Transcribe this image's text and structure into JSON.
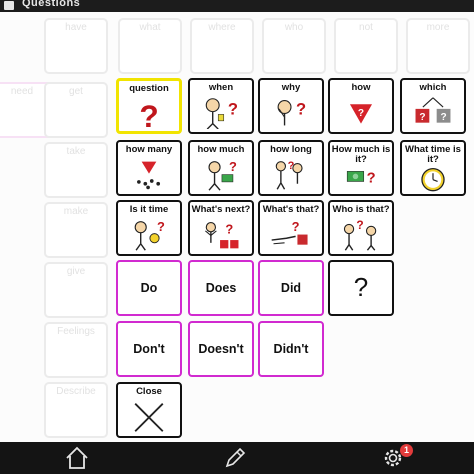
{
  "topbar": {
    "title": "Questions"
  },
  "background_tiles": [
    {
      "label": "what"
    },
    {
      "label": "where"
    },
    {
      "label": "who"
    },
    {
      "label": "not"
    },
    {
      "label": "more"
    },
    {
      "label": "need"
    },
    {
      "label": "get"
    },
    {
      "label": "take"
    },
    {
      "label": "make"
    },
    {
      "label": "give"
    },
    {
      "label": "Feelings"
    },
    {
      "label": "Describe"
    },
    {
      "label": "have"
    }
  ],
  "popup": {
    "row1": [
      "question",
      "when",
      "why",
      "how",
      "which"
    ],
    "row2": [
      "how many",
      "how much",
      "how long",
      "How much is it?",
      "What time is it?"
    ],
    "row3": [
      "Is it time",
      "What's next?",
      "What's that?",
      "Who is that?"
    ],
    "row4": [
      "Do",
      "Does",
      "Did",
      "?"
    ],
    "row5": [
      "Don't",
      "Doesn't",
      "Didn't"
    ],
    "close": "Close"
  },
  "bottombar": {
    "settings_badge": "1"
  },
  "colors": {
    "accent_pink": "#d12ad0",
    "selected_yellow": "#f1e400",
    "question_red": "#c0161c"
  }
}
